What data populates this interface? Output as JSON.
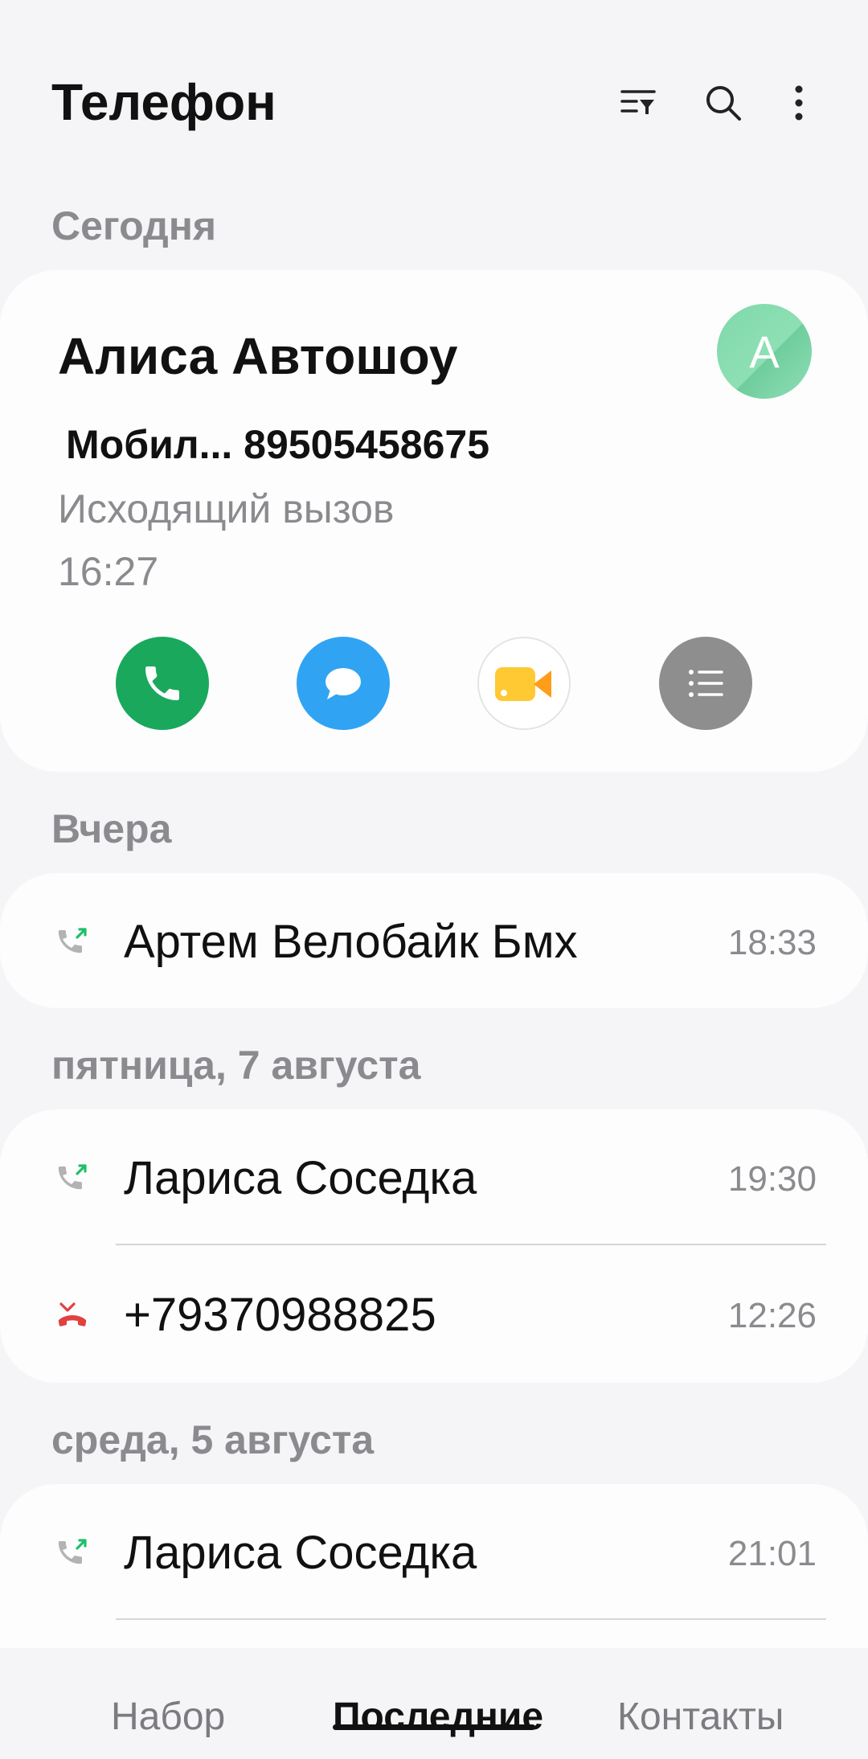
{
  "header": {
    "title": "Телефон"
  },
  "sections": {
    "today": "Сегодня",
    "yesterday": "Вчера",
    "friday": "пятница, 7 августа",
    "wednesday": "среда, 5 августа"
  },
  "expanded_call": {
    "name": "Алиса Автошоу",
    "avatar_letter": "A",
    "number_line": "Мобил... 89505458675",
    "type": "Исходящий вызов",
    "time": "16:27"
  },
  "calls": {
    "yesterday": [
      {
        "name": "Артем Велобайк Бмх",
        "time": "18:33",
        "direction": "outgoing"
      }
    ],
    "friday": [
      {
        "name": "Лариса Соседка",
        "time": "19:30",
        "direction": "outgoing"
      },
      {
        "name": "+79370988825",
        "time": "12:26",
        "direction": "rejected"
      }
    ],
    "wednesday": [
      {
        "name": "Лариса Соседка",
        "time": "21:01",
        "direction": "outgoing"
      }
    ]
  },
  "bottom_nav": {
    "keypad": "Набор",
    "recents": "Последние",
    "contacts": "Контакты",
    "active": "recents"
  },
  "colors": {
    "call_button": "#1aa85c",
    "message_button": "#30a4f3",
    "details_button": "#8e8e8e",
    "outgoing_arrow": "#1fbf6a",
    "rejected_icon": "#e0413f"
  }
}
